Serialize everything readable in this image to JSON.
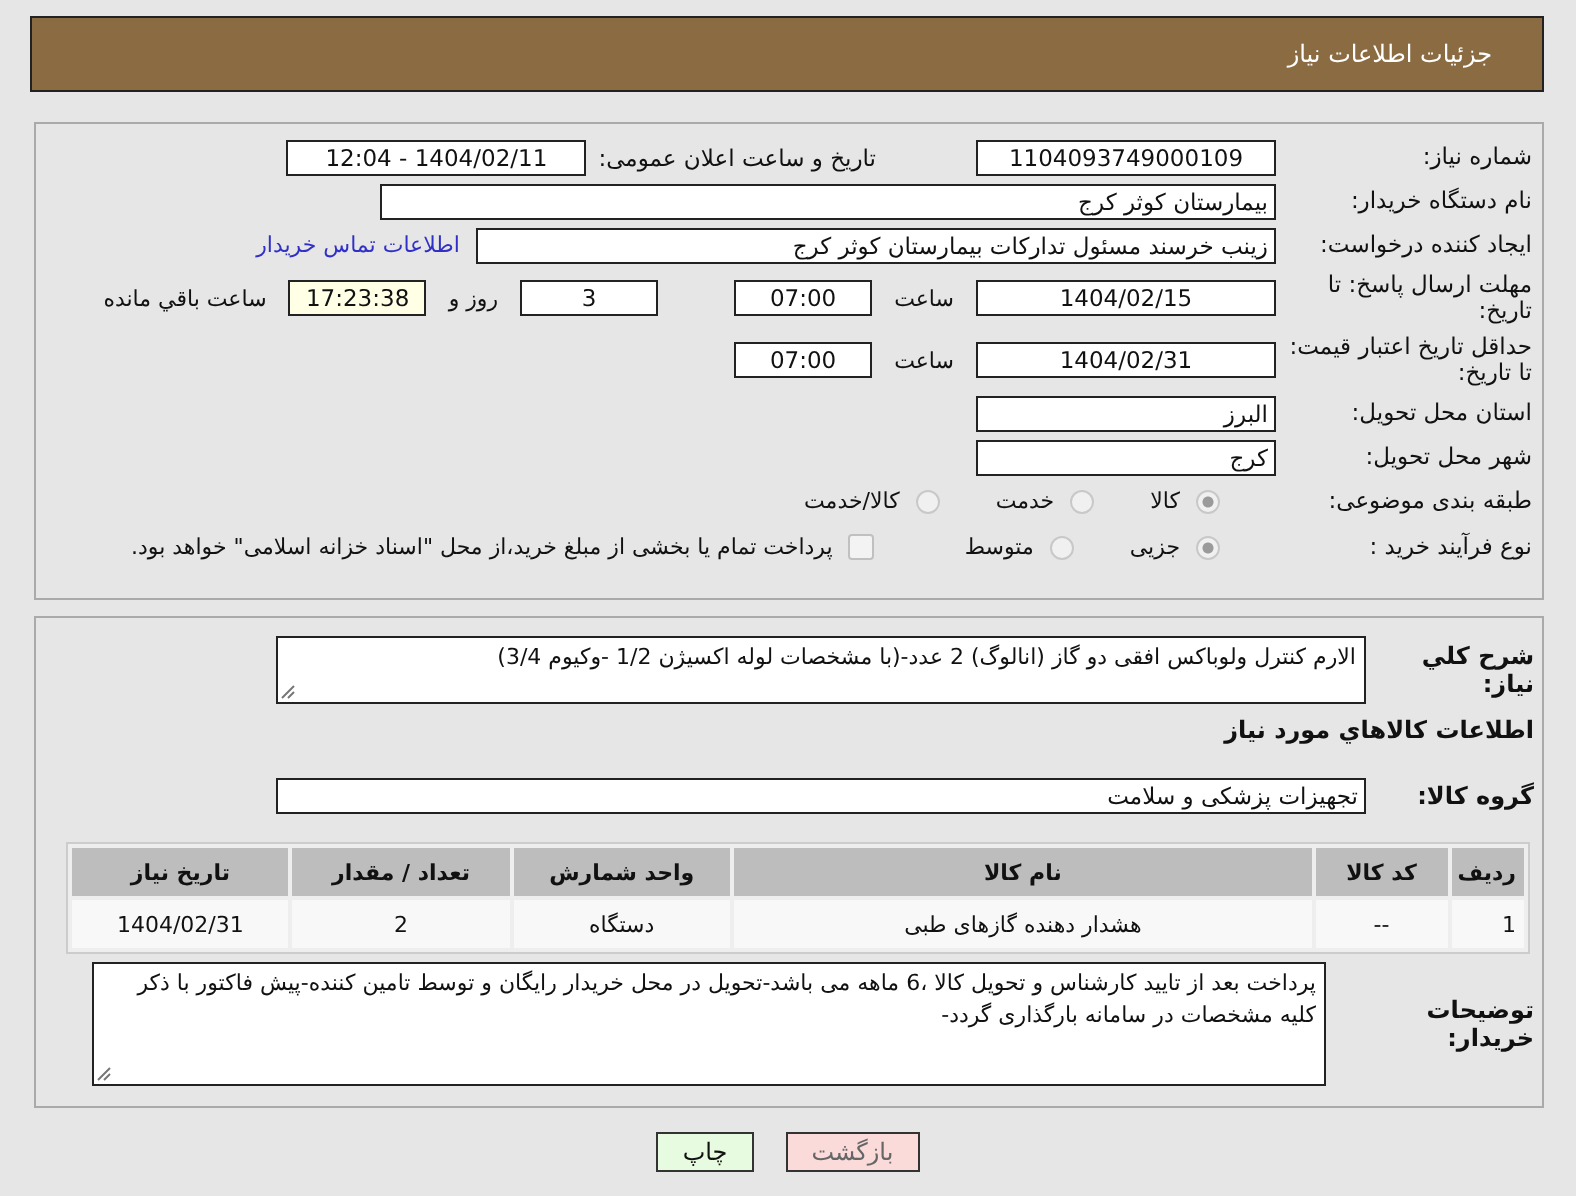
{
  "header": {
    "title": "جزئیات اطلاعات نیاز"
  },
  "need_number": {
    "label": "شماره نیاز:",
    "value": "1104093749000109"
  },
  "announce": {
    "label": "تاریخ و ساعت اعلان عمومی:",
    "value": "1404/02/11 - 12:04"
  },
  "buyer_org": {
    "label": "نام دستگاه خریدار:",
    "value": "بیمارستان کوثر کرج"
  },
  "requester": {
    "label": "ایجاد کننده درخواست:",
    "value": "زینب خرسند مسئول تدارکات بیمارستان کوثر کرج",
    "link": "اطلاعات تماس خریدار"
  },
  "deadline": {
    "label": "مهلت ارسال پاسخ: تا تاریخ:",
    "date": "1404/02/15",
    "time_label": "ساعت",
    "time": "07:00",
    "days": "3",
    "days_label": "روز و",
    "remaining": "17:23:38",
    "remaining_label": "ساعت باقي مانده"
  },
  "price_validity": {
    "label": "حداقل تاریخ اعتبار قیمت: تا تاریخ:",
    "date": "1404/02/31",
    "time_label": "ساعت",
    "time": "07:00"
  },
  "province": {
    "label": "استان محل تحویل:",
    "value": "البرز"
  },
  "city": {
    "label": "شهر محل تحویل:",
    "value": "کرج"
  },
  "category": {
    "label": "طبقه بندی موضوعی:",
    "options": [
      {
        "label": "کالا",
        "selected": true
      },
      {
        "label": "خدمت",
        "selected": false
      },
      {
        "label": "کالا/خدمت",
        "selected": false
      }
    ]
  },
  "process": {
    "label": "نوع فرآیند خرید :",
    "options": [
      {
        "label": "جزیی",
        "selected": true
      },
      {
        "label": "متوسط",
        "selected": false
      }
    ],
    "treasury": {
      "label": "پرداخت تمام یا بخشی از مبلغ خرید،از محل \"اسناد خزانه اسلامی\" خواهد بود.",
      "checked": false
    }
  },
  "description": {
    "label": "شرح کلي نياز:",
    "value": "الارم کنترل ولوباکس افقی دو گاز (انالوگ) 2 عدد-(با مشخصات لوله اکسیژن 1/2 -وکیوم 3/4)"
  },
  "goods_heading": "اطلاعات کالاهاي مورد نياز",
  "goods_group": {
    "label": "گروه کالا:",
    "value": "تجهیزات پزشکی و سلامت"
  },
  "table": {
    "columns": [
      "ردیف",
      "کد کالا",
      "نام کالا",
      "واحد شمارش",
      "تعداد / مقدار",
      "تاریخ نیاز"
    ],
    "rows": [
      [
        "1",
        "--",
        "هشدار دهنده گازهای طبی",
        "دستگاه",
        "2",
        "1404/02/31"
      ]
    ]
  },
  "buyer_notes": {
    "label": "توضیحات خریدار:",
    "value": "پرداخت بعد از تایید کارشناس و تحویل کالا ،6 ماهه می باشد-تحویل در محل خریدار رایگان و توسط تامین کننده-پیش فاکتور با ذکر کلیه مشخصات در سامانه بارگذاری گردد-"
  },
  "buttons": [
    {
      "label": "بازگشت",
      "kind": "back"
    },
    {
      "label": "چاپ",
      "kind": "print"
    }
  ]
}
